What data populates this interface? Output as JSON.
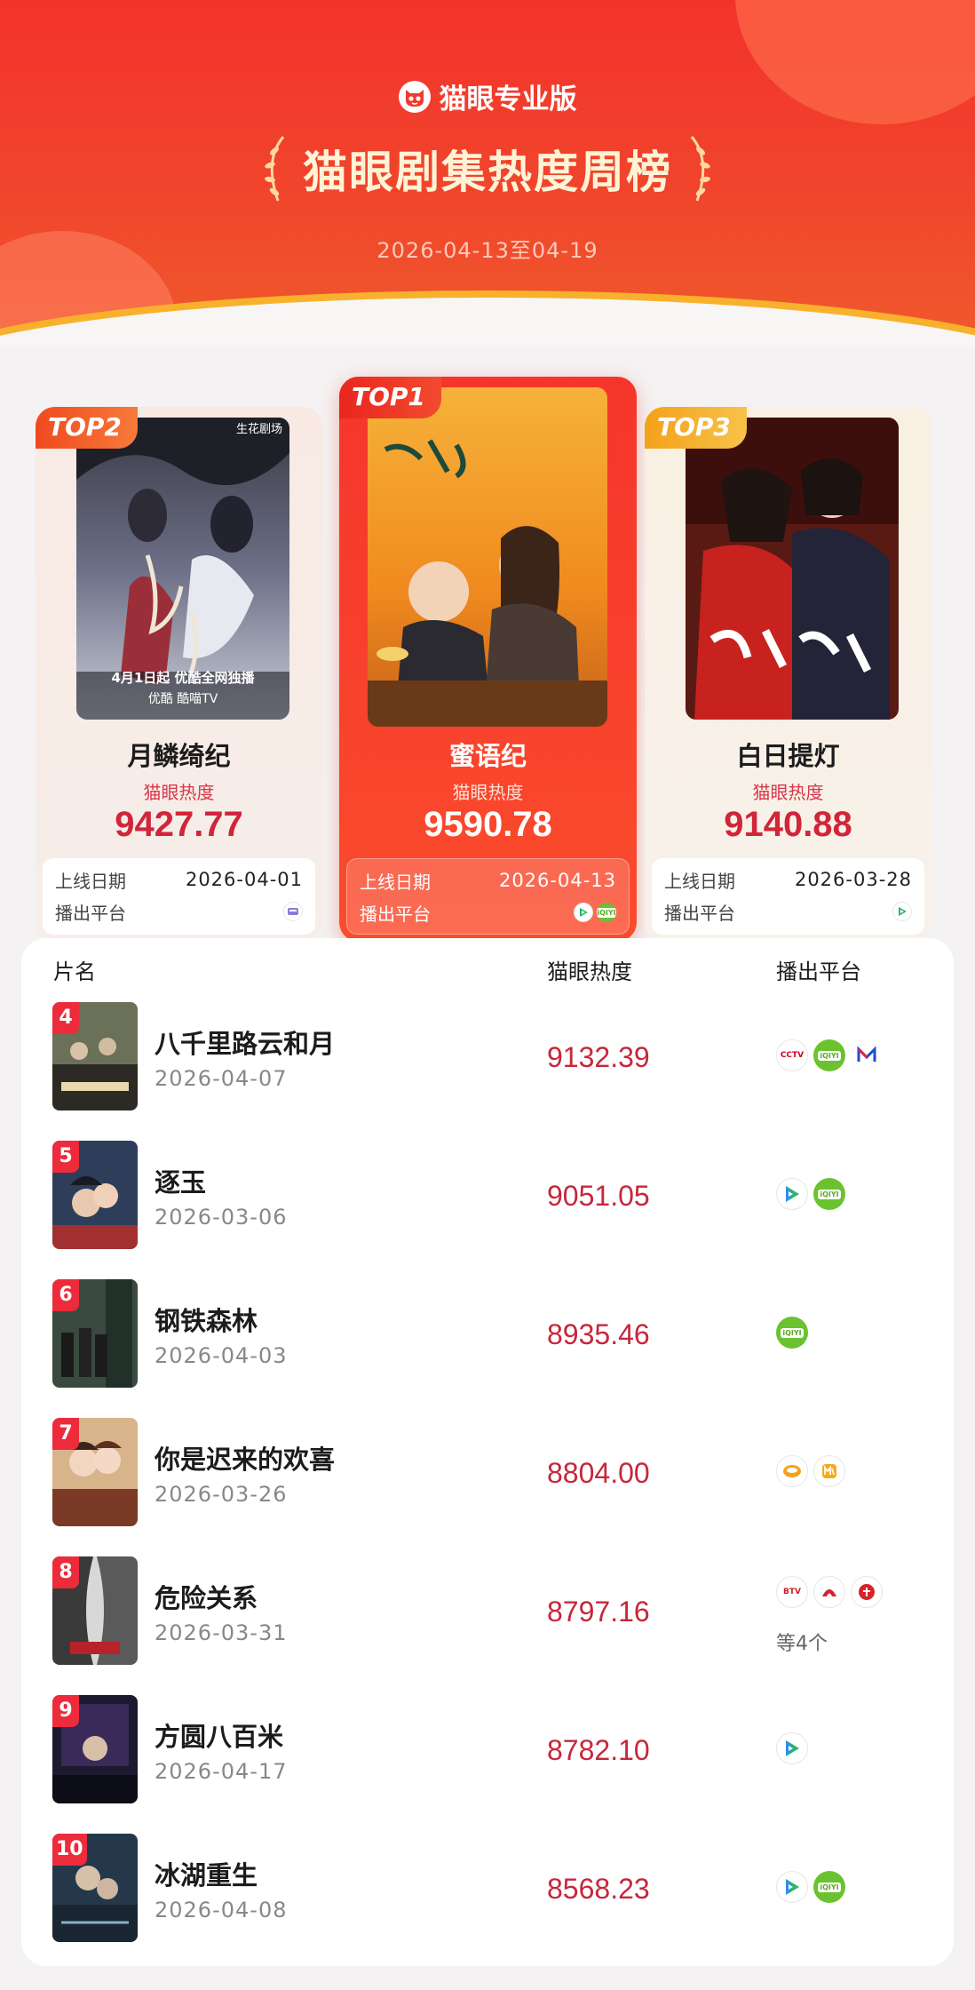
{
  "header": {
    "brand": "猫眼专业版",
    "title": "猫眼剧集热度周榜",
    "date_range": "2026-04-13至04-19"
  },
  "colors": {
    "accent_red": "#f3322c",
    "heat_red": "#c8263a",
    "top3_tag": "#f5a11a"
  },
  "top3": [
    {
      "rank_tag": "TOP2",
      "name": "月鳞绮纪",
      "heat_label": "猫眼热度",
      "heat": "9427.77",
      "release_label": "上线日期",
      "release": "2026-04-01",
      "platform_label": "播出平台",
      "platform_icons": [
        "youku-icon"
      ]
    },
    {
      "rank_tag": "TOP1",
      "name": "蜜语纪",
      "heat_label": "猫眼热度",
      "heat": "9590.78",
      "release_label": "上线日期",
      "release": "2026-04-13",
      "platform_label": "播出平台",
      "platform_icons": [
        "tencent-video-icon",
        "iqiyi-icon"
      ]
    },
    {
      "rank_tag": "TOP3",
      "name": "白日提灯",
      "heat_label": "猫眼热度",
      "heat": "9140.88",
      "release_label": "上线日期",
      "release": "2026-03-28",
      "platform_label": "播出平台",
      "platform_icons": [
        "tencent-video-icon"
      ]
    }
  ],
  "poster_texts": {
    "top2_caption": "4月1日起 优酷全网独播",
    "top2_sub": "优酷  酷喵TV",
    "top2_badge": "生花剧场"
  },
  "list": {
    "headers": {
      "name": "片名",
      "heat": "猫眼热度",
      "platform": "播出平台"
    },
    "rows": [
      {
        "rank": "4",
        "name": "八千里路云和月",
        "date": "2026-04-07",
        "heat": "9132.39",
        "platforms": [
          "cctv-icon",
          "iqiyi-icon",
          "mgtv-icon"
        ],
        "more": ""
      },
      {
        "rank": "5",
        "name": "逐玉",
        "date": "2026-03-06",
        "heat": "9051.05",
        "platforms": [
          "tencent-video-icon",
          "iqiyi-icon"
        ],
        "more": ""
      },
      {
        "rank": "6",
        "name": "钢铁森林",
        "date": "2026-04-03",
        "heat": "8935.46",
        "platforms": [
          "iqiyi-icon"
        ],
        "more": ""
      },
      {
        "rank": "7",
        "name": "你是迟来的欢喜",
        "date": "2026-03-26",
        "heat": "8804.00",
        "platforms": [
          "hunan-tv-icon",
          "mango-tv-icon"
        ],
        "more": ""
      },
      {
        "rank": "8",
        "name": "危险关系",
        "date": "2026-03-31",
        "heat": "8797.16",
        "platforms": [
          "btv-icon",
          "dragon-tv-icon",
          "jiangsu-tv-icon"
        ],
        "more": "等4个"
      },
      {
        "rank": "9",
        "name": "方圆八百米",
        "date": "2026-04-17",
        "heat": "8782.10",
        "platforms": [
          "tencent-video-icon"
        ],
        "more": ""
      },
      {
        "rank": "10",
        "name": "冰湖重生",
        "date": "2026-04-08",
        "heat": "8568.23",
        "platforms": [
          "tencent-video-icon",
          "iqiyi-icon"
        ],
        "more": ""
      }
    ]
  }
}
